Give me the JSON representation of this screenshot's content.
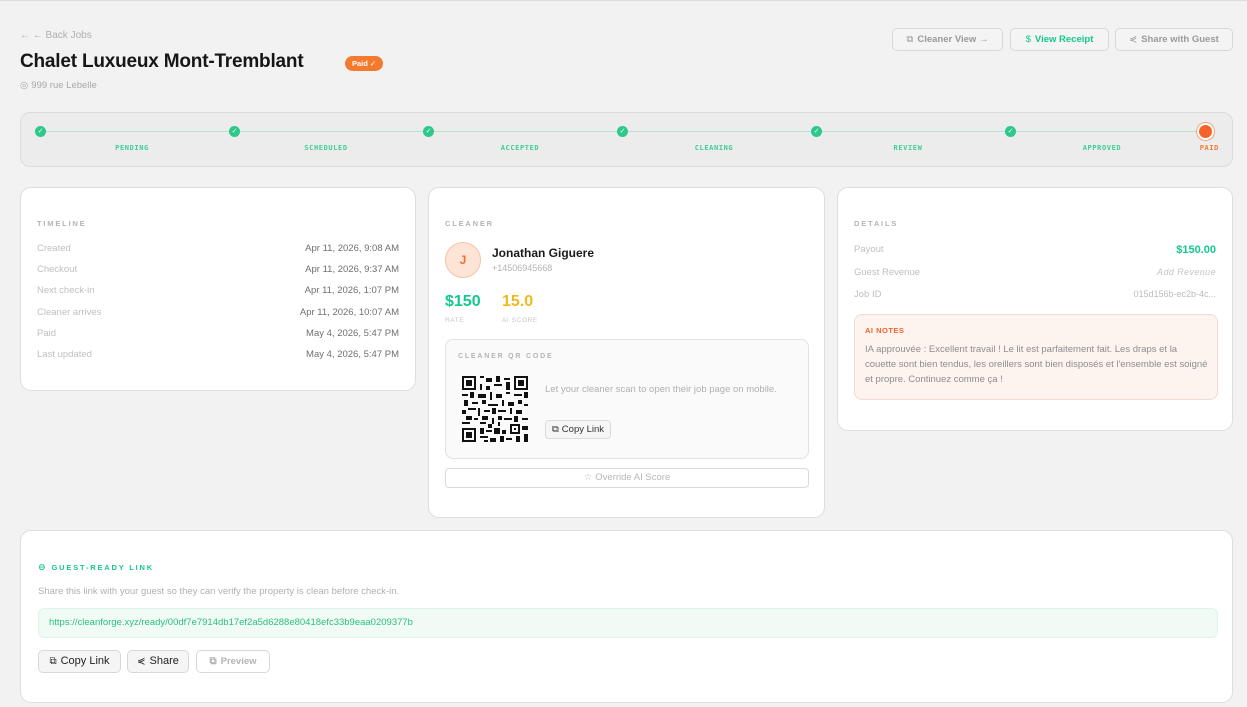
{
  "header": {
    "back_label": "← ← Back Jobs",
    "title": "Chalet Luxueux Mont-Tremblant",
    "status_badge": "Paid ✓",
    "address": "999 rue Lebelle"
  },
  "actions": {
    "cleaner_view": "Cleaner View →",
    "view_receipt": "View Receipt",
    "share_with_guest": "Share with Guest"
  },
  "stepper": {
    "steps": [
      "PENDING",
      "SCHEDULED",
      "ACCEPTED",
      "CLEANING",
      "REVIEW",
      "APPROVED",
      "PAID"
    ],
    "current": "PAID"
  },
  "timeline": {
    "title": "TIMELINE",
    "rows": [
      {
        "label": "Created",
        "value": "Apr 11, 2026, 9:08 AM"
      },
      {
        "label": "Checkout",
        "value": "Apr 11, 2026, 9:37 AM"
      },
      {
        "label": "Next check-in",
        "value": "Apr 11, 2026, 1:07 PM"
      },
      {
        "label": "Cleaner arrives",
        "value": "Apr 11, 2026, 10:07 AM"
      },
      {
        "label": "Paid",
        "value": "May 4, 2026, 5:47 PM"
      },
      {
        "label": "Last updated",
        "value": "May 4, 2026, 5:47 PM"
      }
    ]
  },
  "cleaner": {
    "title": "CLEANER",
    "initial": "J",
    "name": "Jonathan Giguere",
    "phone": "+14506945668",
    "rate": "$150",
    "rate_label": "RATE",
    "ai_score": "15.0",
    "ai_score_label": "AI SCORE",
    "qr_title": "CLEANER QR CODE",
    "qr_text": "Let your cleaner scan to open their job page on mobile.",
    "copy_link": "Copy Link",
    "override": "Override AI Score"
  },
  "details": {
    "title": "DETAILS",
    "payout_label": "Payout",
    "payout_value": "$150.00",
    "guest_revenue_label": "Guest Revenue",
    "guest_revenue_value": "Add Revenue",
    "job_id_label": "Job ID",
    "job_id_value": "015d156b-ec2b-4c...",
    "ai_notes_title": "AI NOTES",
    "ai_notes_text": "IA approuvée : Excellent travail ! Le lit est parfaitement fait. Les draps et la couette sont bien tendus, les oreillers sont bien disposés et l'ensemble est soigné et propre. Continuez comme ça !"
  },
  "guest_link": {
    "title": "GUEST-READY LINK",
    "description": "Share this link with your guest so they can verify the property is clean before check-in.",
    "url": "https://cleanforge.xyz/ready/00df7e7914db17ef2a5d6288e80418efc33b9eaa0209377b",
    "copy_link": "Copy Link",
    "share": "Share",
    "preview": "Preview"
  },
  "colors": {
    "accent_green": "#14c98a",
    "accent_orange": "#f4632a",
    "score_yellow": "#f1b81e"
  }
}
